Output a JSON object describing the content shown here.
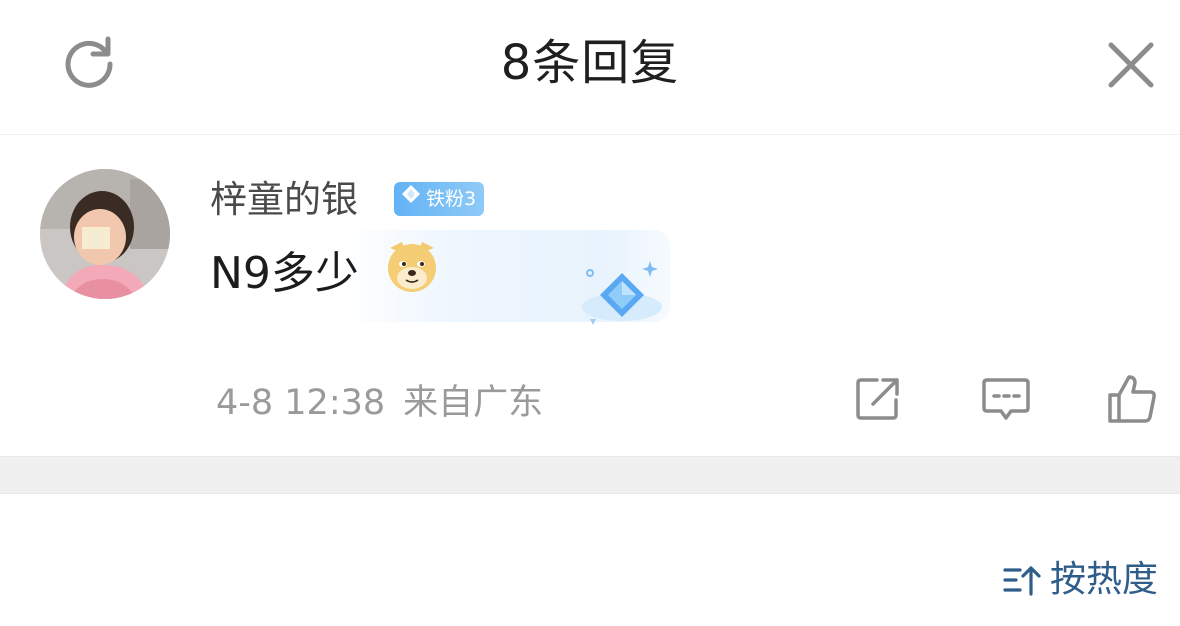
{
  "header": {
    "title": "8条回复",
    "refresh_icon": "refresh-icon",
    "close_icon": "close-icon"
  },
  "reply": {
    "username": "梓童的银",
    "badge_label": "铁粉3",
    "badge_icon": "diamond-icon",
    "content": "N9多少",
    "emoji": "doge-emoji",
    "time": "4-8 12:38",
    "location": "来自广东",
    "actions": {
      "share_icon": "share-icon",
      "comment_icon": "comment-icon",
      "like_icon": "thumbs-up-icon"
    }
  },
  "sort": {
    "label": "按热度",
    "icon": "sort-icon"
  },
  "colors": {
    "badge": "#62b3f5",
    "sort_text": "#2f5d8a",
    "meta_text": "#9a9a9a",
    "divider_band": "#f0f0f0"
  }
}
